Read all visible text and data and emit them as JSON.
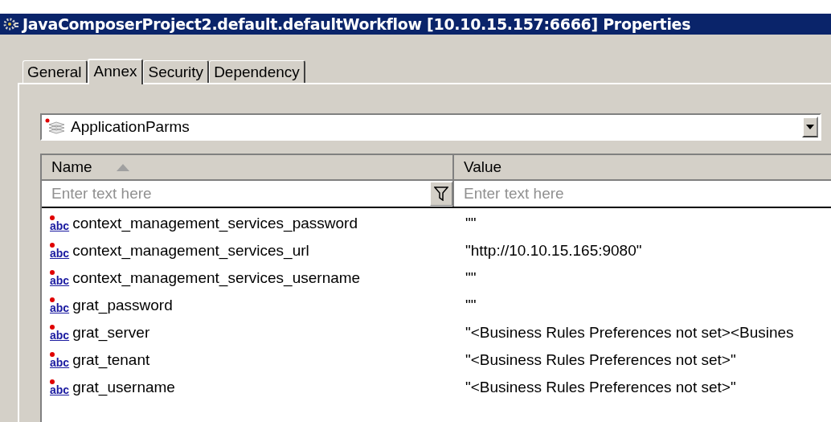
{
  "window": {
    "title": "JavaComposerProject2.default.defaultWorkflow [10.10.15.157:6666] Properties"
  },
  "tabs": [
    {
      "label": "General",
      "selected": false
    },
    {
      "label": "Annex",
      "selected": true
    },
    {
      "label": "Security",
      "selected": false
    },
    {
      "label": "Dependency",
      "selected": false
    }
  ],
  "combo": {
    "value": "ApplicationParms"
  },
  "table": {
    "columns": [
      {
        "label": "Name",
        "sorted": true,
        "placeholder": "Enter text here"
      },
      {
        "label": "Value",
        "sorted": false,
        "placeholder": "Enter text here"
      }
    ],
    "rows": [
      {
        "type_icon": "abc",
        "name": "context_management_services_password",
        "value": "\"\""
      },
      {
        "type_icon": "abc",
        "name": "context_management_services_url",
        "value": "\"http://10.10.15.165:9080\""
      },
      {
        "type_icon": "abc",
        "name": "context_management_services_username",
        "value": "\"\""
      },
      {
        "type_icon": "abc",
        "name": "grat_password",
        "value": "\"\""
      },
      {
        "type_icon": "abc",
        "name": "grat_server",
        "value": "\"<Business Rules Preferences not set><Busines"
      },
      {
        "type_icon": "abc",
        "name": "grat_tenant",
        "value": "\"<Business Rules Preferences not set>\""
      },
      {
        "type_icon": "abc",
        "name": "grat_username",
        "value": "\"<Business Rules Preferences not set>\""
      }
    ]
  }
}
